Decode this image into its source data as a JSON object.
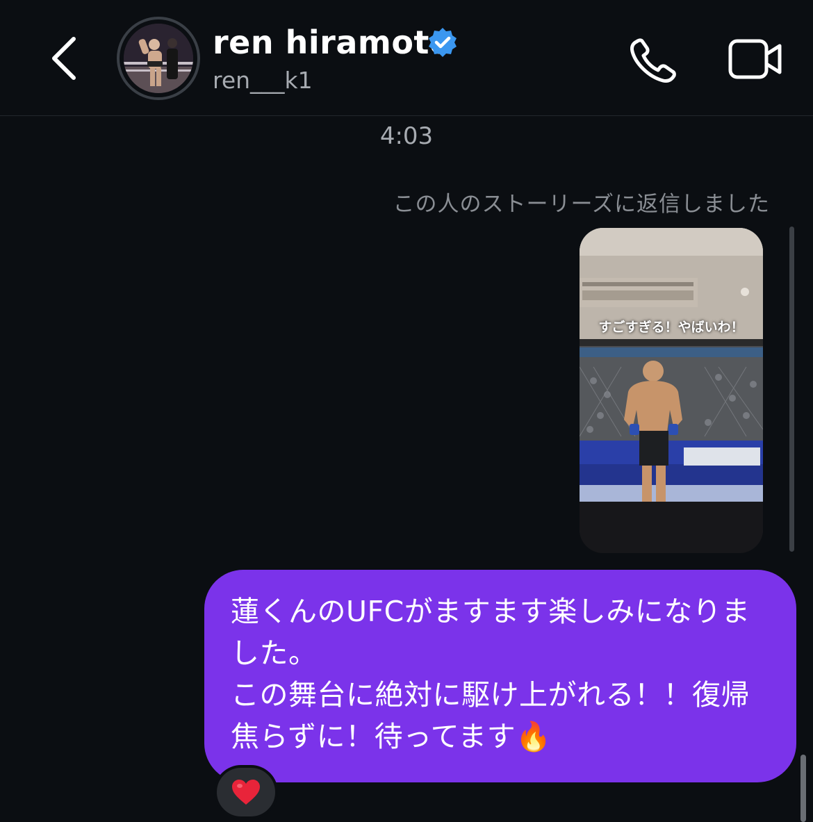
{
  "header": {
    "name": "ren hiramoto",
    "handle": "ren___k1",
    "verified": true,
    "icons": {
      "back": "chevron-left-icon",
      "call": "phone-icon",
      "video": "video-camera-icon",
      "verified": "verified-badge-icon"
    },
    "colors": {
      "verified": "#3b97f0",
      "background": "#0b0e12"
    }
  },
  "thread": {
    "timestamp": "4:03",
    "story_reply_note": "この人のストーリーズに返信しました",
    "story": {
      "caption": "すごすぎる！やばいわ！"
    },
    "message": {
      "text": "蓮くんのUFCがますます楽しみになりました。\nこの舞台に絶対に駆け上がれる！！復帰焦らずに！待ってます🔥",
      "bubble_color": "#7b33ea"
    },
    "reaction": {
      "emoji": "❤️"
    }
  }
}
